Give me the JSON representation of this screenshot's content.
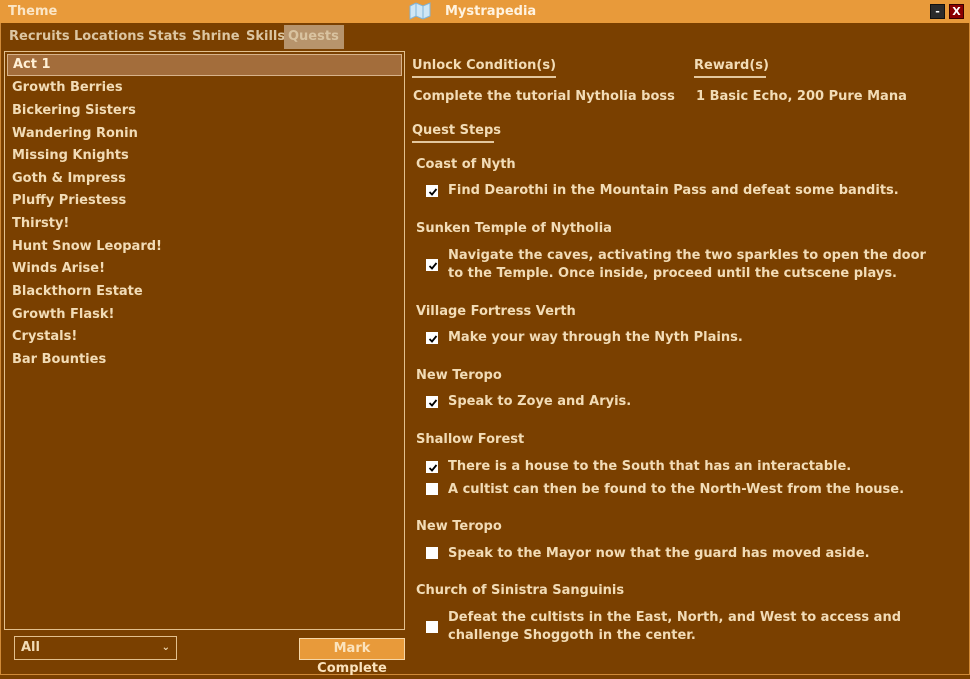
{
  "window": {
    "theme_label": "Theme",
    "title": "Mystrapedia",
    "minimize_label": "-",
    "close_label": "X"
  },
  "tabs": [
    "Recruits",
    "Locations",
    "Stats",
    "Shrine",
    "Skills",
    "Quests"
  ],
  "active_tab": "Quests",
  "quest_list": [
    "Act 1",
    "Growth Berries",
    "Bickering Sisters",
    "Wandering Ronin",
    "Missing Knights",
    "Goth & Impress",
    "Pluffy Priestess",
    "Thirsty!",
    "Hunt Snow Leopard!",
    "Winds Arise!",
    "Blackthorn Estate",
    "Growth Flask!",
    "Crystals!",
    "Bar Bounties"
  ],
  "selected_quest": "Act 1",
  "filter": {
    "value": "All"
  },
  "mark_complete_label": "Mark Complete",
  "details": {
    "unlock_header": "Unlock Condition(s)",
    "unlock_value": "Complete the tutorial Nytholia boss",
    "reward_header": "Reward(s)",
    "reward_value": "1 Basic Echo, 200 Pure Mana",
    "steps_header": "Quest Steps"
  },
  "steps": [
    {
      "location": "Coast of Nyth",
      "text": "Find Dearothi in the Mountain Pass and defeat some bandits.",
      "checked": true
    },
    {
      "location": "Sunken Temple of Nytholia",
      "text": "Navigate the caves, activating the two sparkles to open the door to the Temple. Once inside, proceed until the cutscene plays.",
      "checked": true
    },
    {
      "location": "Village Fortress Verth",
      "text": "Make your way through the Nyth Plains.",
      "checked": true
    },
    {
      "location": "New Teropo",
      "text": "Speak to Zoye and Aryis.",
      "checked": true
    },
    {
      "location": "Shallow Forest",
      "text": "There is a house to the South that has an interactable.",
      "checked": true
    },
    {
      "location": "",
      "text": "A cultist can then be found to the North-West from the house.",
      "checked": false
    },
    {
      "location": "New Teropo",
      "text": "Speak to the Mayor now that the guard has moved aside.",
      "checked": false
    },
    {
      "location": "Church of Sinistra Sanguinis",
      "text": "Defeat the cultists in the East, North, and West to access and challenge Shoggoth in the center.",
      "checked": false
    }
  ],
  "colors": {
    "background": "#7a4000",
    "title_bar": "#e89a3a",
    "text": "#f2dcb6",
    "selection": "#a36d3b"
  }
}
